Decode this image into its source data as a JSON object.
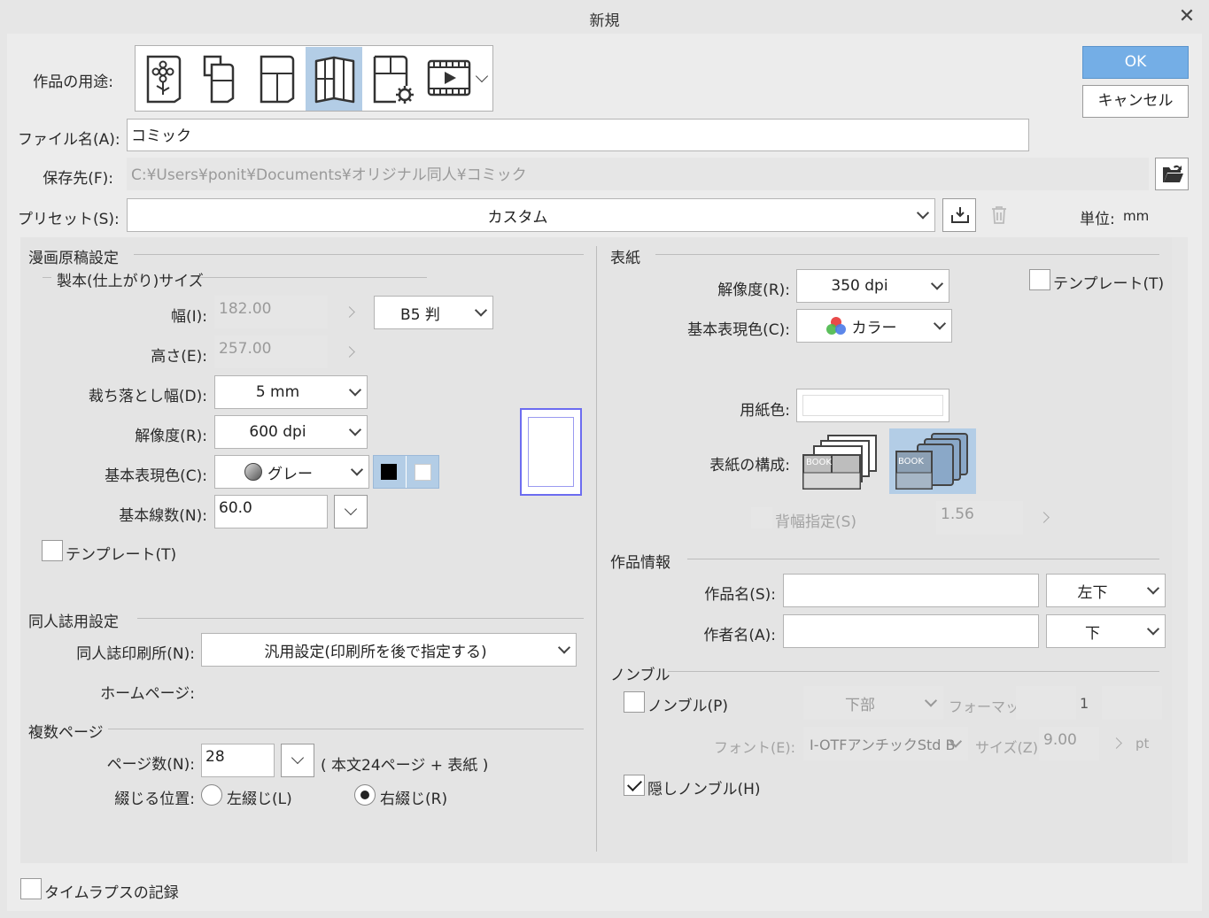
{
  "window": {
    "title": "新規",
    "ok": "OK",
    "cancel": "キャンセル"
  },
  "header": {
    "usage_label": "作品の用途:",
    "usage_options": [
      "illustration",
      "webtoon",
      "comic",
      "comic-book",
      "custom-settings",
      "animation"
    ],
    "usage_selected": "comic-book",
    "filename_label": "ファイル名(A):",
    "filename_value": "コミック",
    "saveto_label": "保存先(F):",
    "saveto_value": "C:¥Users¥ponit¥Documents¥オリジナル同人¥コミック",
    "preset_label": "プリセット(S):",
    "preset_value": "カスタム",
    "unit_label": "単位:",
    "unit_value": "mm"
  },
  "manga": {
    "section": "漫画原稿設定",
    "size_section": "製本(仕上がり)サイズ",
    "width_label": "幅(I):",
    "width_value": "182.00",
    "height_label": "高さ(E):",
    "height_value": "257.00",
    "size_preset": "B5 判",
    "bleed_label": "裁ち落とし幅(D):",
    "bleed_value": "5 mm",
    "res_label": "解像度(R):",
    "res_value": "600 dpi",
    "color_label": "基本表現色(C):",
    "color_value": "グレー",
    "lines_label": "基本線数(N):",
    "lines_value": "60.0",
    "template_label": "テンプレート(T)"
  },
  "doujin": {
    "section": "同人誌用設定",
    "printer_label": "同人誌印刷所(N):",
    "printer_value": "汎用設定(印刷所を後で指定する)",
    "homepage_label": "ホームページ:"
  },
  "pages": {
    "section": "複数ページ",
    "count_label": "ページ数(N):",
    "count_value": "28",
    "count_note": "( 本文24ページ + 表紙 )",
    "binding_label": "綴じる位置:",
    "left_binding": "左綴じ(L)",
    "right_binding": "右綴じ(R)",
    "binding_selected": "right"
  },
  "cover": {
    "section": "表紙",
    "res_label": "解像度(R):",
    "res_value": "350 dpi",
    "template_label": "テンプレート(T)",
    "color_label": "基本表現色(C):",
    "color_value": "カラー",
    "paper_label": "用紙色:",
    "structure_label": "表紙の構成:",
    "book_text": "BOOK",
    "spine_label": "背幅指定(S)",
    "spine_value": "1.56"
  },
  "info": {
    "section": "作品情報",
    "title_label": "作品名(S):",
    "title_pos": "左下",
    "author_label": "作者名(A):",
    "author_pos": "下"
  },
  "nombre": {
    "section": "ノンブル",
    "nombre_label": "ノンブル(P)",
    "position": "下部",
    "format_label": "フォーマット:",
    "format_value": "1",
    "font_label": "フォント(E):",
    "font_value": "I-OTFアンチックStd B",
    "size_label": "サイズ(Z):",
    "size_value": "9.00",
    "size_unit": "pt",
    "hidden_label": "隠しノンブル(H)"
  },
  "footer": {
    "timelapse_label": "タイムラプスの記録"
  },
  "colors": {
    "accent": "#74aee6",
    "selected": "#b3cde6",
    "panel": "#e4e4e4"
  }
}
